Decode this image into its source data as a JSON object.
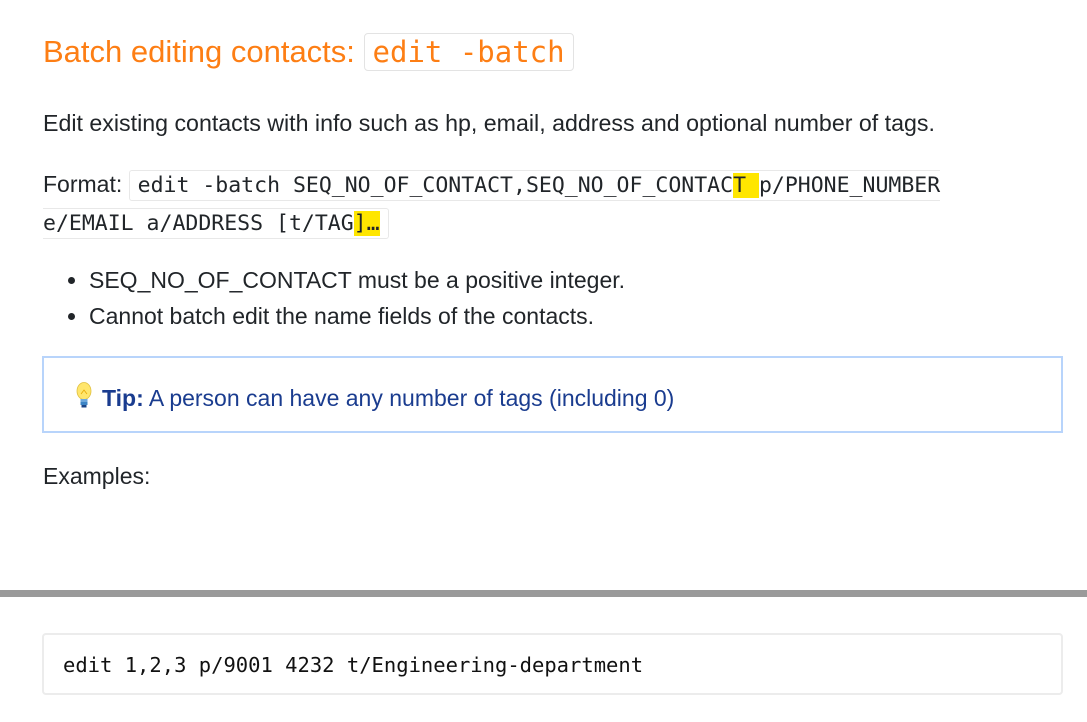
{
  "heading": {
    "text": "Batch editing contacts: ",
    "code": "edit -batch"
  },
  "description": "Edit existing contacts with info such as hp, email, address and optional number of tags.",
  "format": {
    "label": "Format: ",
    "code_part1": "edit -batch SEQ_NO_OF_CONTACT,SEQ_NO_OF_CONTAC",
    "code_hl1": "T ",
    "code_part2": "p/PHONE_NUMBER e/EMAIL a/ADDRESS [t/TAG",
    "code_hl2": "]…"
  },
  "bullets": [
    "SEQ_NO_OF_CONTACT must be a positive integer.",
    "Cannot batch edit the name fields of the contacts."
  ],
  "tip": {
    "label": "Tip:",
    "text": " A person can have any number of tags (including 0)"
  },
  "examples_label": "Examples:",
  "example_code": "edit 1,2,3 p/9001 4232 t/Engineering-department"
}
